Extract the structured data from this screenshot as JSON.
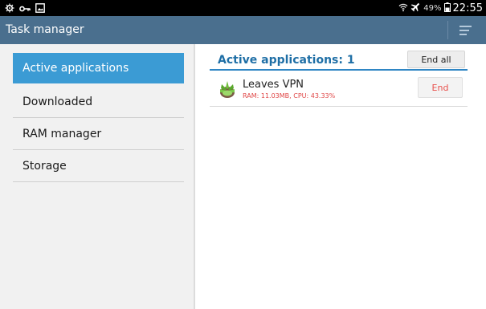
{
  "status_bar": {
    "battery_text": "49%",
    "time": "22:55",
    "left_icons": [
      "settings-icon",
      "key-icon",
      "image-icon"
    ],
    "right_icons": [
      "wifi-icon",
      "airplane-icon",
      "battery-icon"
    ]
  },
  "action_bar": {
    "title": "Task manager",
    "menu_icon": "menu-icon"
  },
  "sidebar": {
    "items": [
      {
        "label": "Active applications",
        "active": true
      },
      {
        "label": "Downloaded",
        "active": false
      },
      {
        "label": "RAM manager",
        "active": false
      },
      {
        "label": "Storage",
        "active": false
      }
    ]
  },
  "main": {
    "section_title": "Active applications: 1",
    "end_all_label": "End all",
    "apps": [
      {
        "name": "Leaves VPN",
        "stats": "RAM: 11.03MB, CPU: 43.33%",
        "end_label": "End",
        "icon": "leaf-app-icon"
      }
    ]
  },
  "colors": {
    "action_bar": "#4a6f8e",
    "active_nav": "#3b9bd4",
    "section_title": "#1f6fa6",
    "stats_red": "#e04848"
  }
}
